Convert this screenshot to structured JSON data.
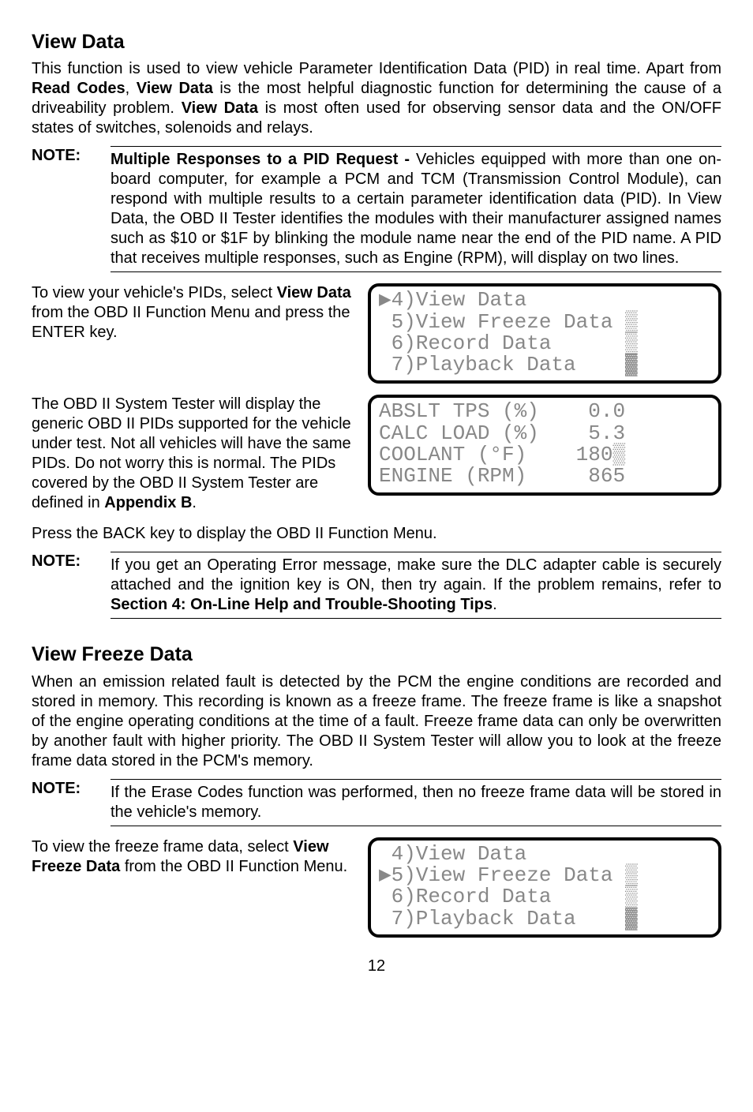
{
  "viewData": {
    "heading": "View Data",
    "intro_a": "This function is used to view vehicle Parameter Identification Data (PID) in real time. Apart from ",
    "intro_b": "Read Codes",
    "intro_c": ", ",
    "intro_d": "View Data",
    "intro_e": " is the most helpful diagnostic function for determining the cause of a driveability problem. ",
    "intro_f": "View Data",
    "intro_g": " is most often used for observing sensor data and the ON/OFF states of switches, solenoids and relays.",
    "note1_label": "NOTE:",
    "note1_title": "Multiple Responses to a PID Request - ",
    "note1_body": "Vehicles equipped with more than one on-board computer, for example a PCM and TCM (Transmission Control Module), can respond with multiple results  to a certain parameter identification data (PID).  In View Data, the OBD II Tester identifies the modules with their manufacturer assigned names such as $10 or $1F by blinking the module name near the end of the PID name.  A PID that receives multiple responses, such as Engine (RPM),  will display  on two lines.",
    "para2_a": "To view your vehicle's PIDs, select ",
    "para2_b": "View Data",
    "para2_c": " from the OBD II Function Menu and press the ENTER key.",
    "para3_a": "The OBD II System Tester will display the generic OBD II PIDs supported for the vehicle under test. Not all vehicles will have the same PIDs. Do not worry this is normal. The PIDs covered by the OBD II System Tester are defined in ",
    "para3_b": "Appendix B",
    "para3_c": ".",
    "para4": "Press the BACK key to display the OBD II Function Menu.",
    "note2_label": "NOTE:",
    "note2_a": "If you get an Operating Error message, make sure the DLC adapter cable is securely attached and the ignition key is ON, then try again. If the problem remains, refer to ",
    "note2_b": "Section 4: On-Line Help and Trouble-Shooting Tips",
    "note2_c": "."
  },
  "screens": {
    "menu1_line1": "▶4)View Data",
    "menu1_line2": " 5)View Freeze Data ▒",
    "menu1_line3": " 6)Record Data      ▒",
    "menu1_line4": " 7)Playback Data    ▓",
    "pid_line1": "ABSLT TPS (%)    0.0",
    "pid_line2": "CALC LOAD (%)    5.3",
    "pid_line3": "COOLANT (°F)    180▒",
    "pid_line4": "ENGINE (RPM)     865",
    "menu2_line1": " 4)View Data",
    "menu2_line2": "▶5)View Freeze Data ▒",
    "menu2_line3": " 6)Record Data      ▒",
    "menu2_line4": " 7)Playback Data    ▓"
  },
  "freeze": {
    "heading": "View Freeze Data",
    "intro": "When an emission related fault is detected by the PCM the engine conditions are recorded and stored in memory. This recording is known as a freeze frame. The freeze frame is like a snapshot of the engine operating conditions at the time of a fault. Freeze frame data can only be overwritten by another fault with higher priority. The OBD II System Tester will allow you to look at the freeze frame data stored in the PCM's memory.",
    "note_label": "NOTE:",
    "note_body": "If  the Erase Codes function was performed, then no freeze frame data will be stored in the vehicle's memory.",
    "para2_a": "To view the freeze frame data, select ",
    "para2_b": "View Freeze Data",
    "para2_c": " from the OBD II Function Menu."
  },
  "pageNumber": "12"
}
